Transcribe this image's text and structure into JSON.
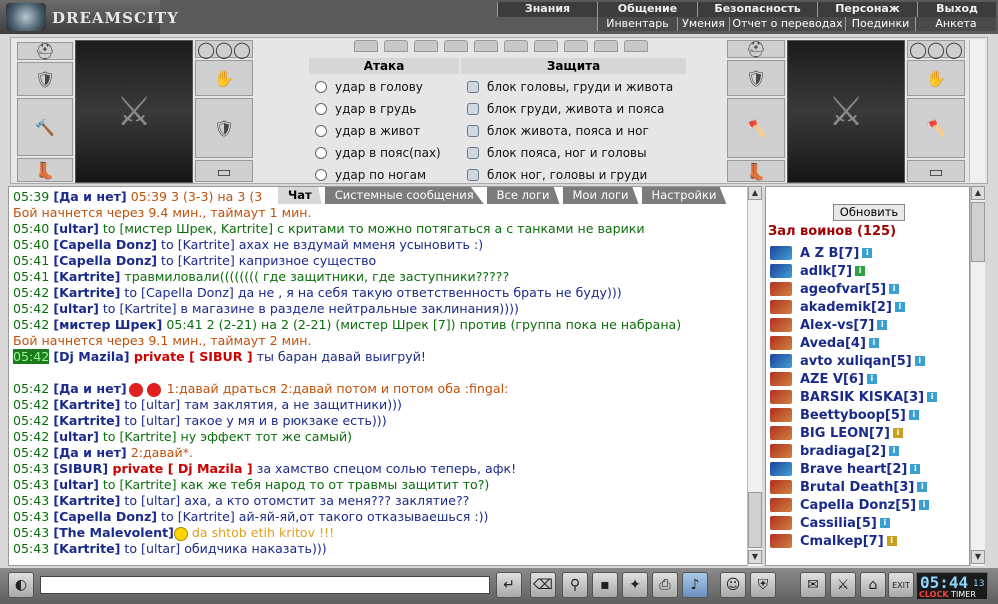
{
  "app": {
    "logo_text": "DREAMSCITY"
  },
  "menu": {
    "top": [
      "Знания",
      "Общение",
      "Безопасность",
      "Персонаж",
      "Выход"
    ],
    "sub": [
      "Инвентарь",
      "Умения",
      "Отчет о переводах",
      "Поединки",
      "Анкета"
    ]
  },
  "battle": {
    "attack_title": "Атака",
    "attack_options": [
      "удар в голову",
      "удар в грудь",
      "удар в живот",
      "удар в пояс(пах)",
      "удар по ногам"
    ],
    "defense_title": "Защита",
    "defense_options": [
      "блок головы, груди и живота",
      "блок груди, живота и пояса",
      "блок живота, пояса и ног",
      "блок пояса, ног и головы",
      "блок ног, головы и груди"
    ]
  },
  "chat_tabs": [
    "Чат",
    "Системные сообщения",
    "Все логи",
    "Мои логи",
    "Настройки"
  ],
  "chat": [
    {
      "time": "05:39",
      "parts": [
        {
          "c": "n",
          "v": "[Да и нет]"
        },
        {
          "c": "sys",
          "v": " 05:39 3 (3-3) на 3 (3"
        }
      ]
    },
    {
      "time": "",
      "parts": [
        {
          "c": "sys",
          "v": "Бой начнется через 9.4 мин., таймаут 1 мин."
        }
      ]
    },
    {
      "time": "05:40",
      "parts": [
        {
          "c": "n",
          "v": "[ultar]"
        },
        {
          "c": "g",
          "v": " to [мистер Шрек, Kartrite] с критами то можно потягаться а с танками не варики"
        }
      ]
    },
    {
      "time": "05:40",
      "parts": [
        {
          "c": "n",
          "v": "[Capella Donz]"
        },
        {
          "c": "b",
          "v": " to [Kartrite] ахах не вздумай мменя усыновить :)"
        }
      ]
    },
    {
      "time": "05:41",
      "parts": [
        {
          "c": "n",
          "v": "[Capella Donz]"
        },
        {
          "c": "b",
          "v": " to [Kartrite] капризное существо"
        }
      ]
    },
    {
      "time": "05:41",
      "parts": [
        {
          "c": "n",
          "v": "[Kartrite]"
        },
        {
          "c": "g",
          "v": " травмиловали(((((((( где защитники, где заступники?????"
        }
      ]
    },
    {
      "time": "05:42",
      "parts": [
        {
          "c": "n",
          "v": "[Kartrite]"
        },
        {
          "c": "b",
          "v": " to [Capella Donz] да не , я на себя такую ответственность брать не буду)))"
        }
      ]
    },
    {
      "time": "05:42",
      "parts": [
        {
          "c": "n",
          "v": "[ultar]"
        },
        {
          "c": "b",
          "v": " to [Kartrite] в магазине в разделе нейтральные заклинания))))"
        }
      ]
    },
    {
      "time": "05:42",
      "parts": [
        {
          "c": "n",
          "v": "[мистер Шрек]"
        },
        {
          "c": "g",
          "v": " 05:41 2 (2-21) на 2 (2-21) (мистер Шрек [7]) против (группа пока не набрана)"
        }
      ]
    },
    {
      "time": "",
      "parts": [
        {
          "c": "sys",
          "v": "Бой начнется через 9.1 мин., таймаут 2 мин."
        }
      ]
    },
    {
      "time": "05:42",
      "hl": true,
      "parts": [
        {
          "c": "n",
          "v": "[Dj Mazila]"
        },
        {
          "c": "red",
          "v": " private [ SIBUR ]"
        },
        {
          "c": "b",
          "v": " ты баран давай выигруй!"
        }
      ]
    },
    {
      "gap": true
    },
    {
      "time": "05:42",
      "parts": [
        {
          "c": "n",
          "v": "[Да и нет]"
        },
        {
          "c": "emoji2",
          "v": ""
        },
        {
          "c": "sys",
          "v": " 1:давай драться 2:давай потом          и потом оба          :fingal:"
        }
      ]
    },
    {
      "time": "05:42",
      "parts": [
        {
          "c": "n",
          "v": "[Kartrite]"
        },
        {
          "c": "b",
          "v": " to [ultar] там заклятия, а не защитники)))"
        }
      ]
    },
    {
      "time": "05:42",
      "parts": [
        {
          "c": "n",
          "v": "[Kartrite]"
        },
        {
          "c": "b",
          "v": " to [ultar] такое у мя и в рюкзаке есть)))"
        }
      ]
    },
    {
      "time": "05:42",
      "parts": [
        {
          "c": "n",
          "v": "[ultar]"
        },
        {
          "c": "g",
          "v": " to [Kartrite] ну эффект тот же самый)"
        }
      ]
    },
    {
      "time": "05:42",
      "parts": [
        {
          "c": "n",
          "v": "[Да и нет]"
        },
        {
          "c": "sys",
          "v": " 2:давай*."
        }
      ]
    },
    {
      "time": "05:43",
      "parts": [
        {
          "c": "n",
          "v": "[SIBUR]"
        },
        {
          "c": "red",
          "v": " private [ Dj Mazila ]"
        },
        {
          "c": "b",
          "v": " за хамство спецом солью теперь, афк!"
        }
      ]
    },
    {
      "time": "05:43",
      "parts": [
        {
          "c": "n",
          "v": "[ultar]"
        },
        {
          "c": "g",
          "v": " to [Kartrite] как же тебя народ то от травмы защитит то?)"
        }
      ]
    },
    {
      "time": "05:43",
      "parts": [
        {
          "c": "n",
          "v": "[Kartrite]"
        },
        {
          "c": "b",
          "v": " to [ultar] аха, а кто отомстит за меня??? заклятие??"
        }
      ]
    },
    {
      "time": "05:43",
      "parts": [
        {
          "c": "n",
          "v": "[Capella Donz]"
        },
        {
          "c": "b",
          "v": " to [Kartrite] ай-яй-яй,от такого отказываешься :))"
        }
      ]
    },
    {
      "time": "05:43",
      "parts": [
        {
          "c": "n",
          "v": "[The Malevolent]"
        },
        {
          "c": "smile",
          "v": ""
        },
        {
          "c": "sysy",
          "v": "  da shtob etih kritov !!!"
        }
      ]
    },
    {
      "time": "05:43",
      "parts": [
        {
          "c": "n",
          "v": "[Kartrite]"
        },
        {
          "c": "b",
          "v": " to [ultar] обидчика наказать)))"
        }
      ]
    }
  ],
  "players": {
    "refresh": "Обновить",
    "hall_title": "Зал воинов (125)",
    "list": [
      {
        "name": "A Z B[7]",
        "icon": "blue",
        "info": "blue"
      },
      {
        "name": "adlk[7]",
        "icon": "blue",
        "info": "green"
      },
      {
        "name": "ageofvar[5]",
        "icon": "red",
        "info": "blue"
      },
      {
        "name": "akademik[2]",
        "icon": "red",
        "info": "blue"
      },
      {
        "name": "Alex-vs[7]",
        "icon": "red",
        "info": "blue"
      },
      {
        "name": "Aveda[4]",
        "icon": "red",
        "info": "blue"
      },
      {
        "name": "avto xuliqan[5]",
        "icon": "blue",
        "info": "blue"
      },
      {
        "name": "AZE V[6]",
        "icon": "red",
        "info": "blue"
      },
      {
        "name": "BARSIK KISKA[3]",
        "icon": "red",
        "info": "blue"
      },
      {
        "name": "Beettyboop[5]",
        "icon": "red",
        "info": "blue"
      },
      {
        "name": "BIG LEON[7]",
        "icon": "red",
        "info": "gold"
      },
      {
        "name": "bradiaga[2]",
        "icon": "red",
        "info": "blue"
      },
      {
        "name": "Brave heart[2]",
        "icon": "blue",
        "info": "blue"
      },
      {
        "name": "Brutal Death[3]",
        "icon": "red",
        "info": "blue"
      },
      {
        "name": "Capella Donz[5]",
        "icon": "red",
        "info": "blue"
      },
      {
        "name": "Cassilia[5]",
        "icon": "red",
        "info": "blue"
      },
      {
        "name": "Cmalkep[7]",
        "icon": "red",
        "info": "gold"
      }
    ]
  },
  "timer": {
    "time": "05:44",
    "seconds": "13",
    "label_clock": "CLOCK",
    "label_timer": "TIMER",
    "exit": "EXIT"
  },
  "colors": {
    "accent": "#1a2a8a",
    "time_green": "#0a6e0a",
    "private_red": "#cc0000",
    "system_orange": "#c0500a"
  }
}
